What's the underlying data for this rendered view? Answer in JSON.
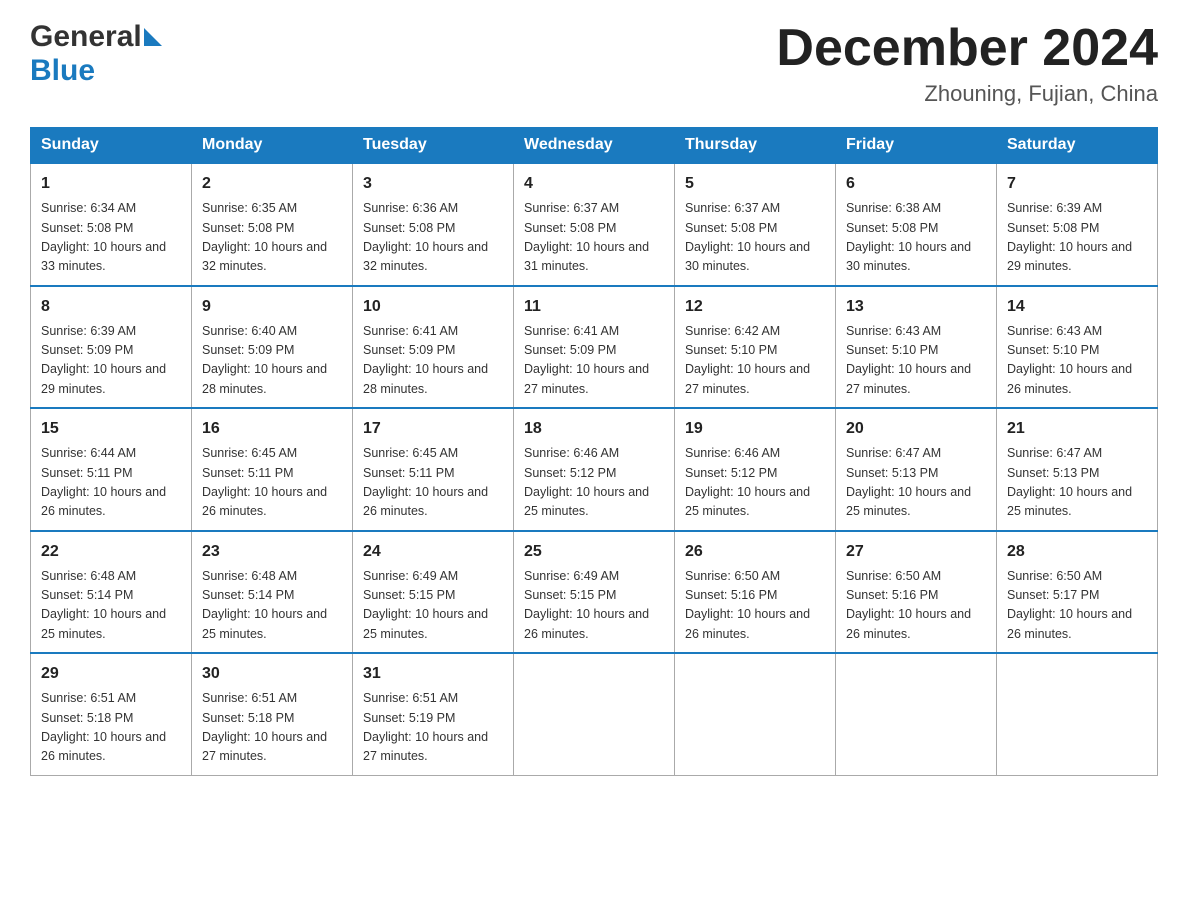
{
  "logo": {
    "general": "General",
    "blue": "Blue"
  },
  "title": {
    "month_year": "December 2024",
    "location": "Zhouning, Fujian, China"
  },
  "weekdays": [
    "Sunday",
    "Monday",
    "Tuesday",
    "Wednesday",
    "Thursday",
    "Friday",
    "Saturday"
  ],
  "weeks": [
    [
      {
        "day": "1",
        "sunrise": "6:34 AM",
        "sunset": "5:08 PM",
        "daylight": "10 hours and 33 minutes."
      },
      {
        "day": "2",
        "sunrise": "6:35 AM",
        "sunset": "5:08 PM",
        "daylight": "10 hours and 32 minutes."
      },
      {
        "day": "3",
        "sunrise": "6:36 AM",
        "sunset": "5:08 PM",
        "daylight": "10 hours and 32 minutes."
      },
      {
        "day": "4",
        "sunrise": "6:37 AM",
        "sunset": "5:08 PM",
        "daylight": "10 hours and 31 minutes."
      },
      {
        "day": "5",
        "sunrise": "6:37 AM",
        "sunset": "5:08 PM",
        "daylight": "10 hours and 30 minutes."
      },
      {
        "day": "6",
        "sunrise": "6:38 AM",
        "sunset": "5:08 PM",
        "daylight": "10 hours and 30 minutes."
      },
      {
        "day": "7",
        "sunrise": "6:39 AM",
        "sunset": "5:08 PM",
        "daylight": "10 hours and 29 minutes."
      }
    ],
    [
      {
        "day": "8",
        "sunrise": "6:39 AM",
        "sunset": "5:09 PM",
        "daylight": "10 hours and 29 minutes."
      },
      {
        "day": "9",
        "sunrise": "6:40 AM",
        "sunset": "5:09 PM",
        "daylight": "10 hours and 28 minutes."
      },
      {
        "day": "10",
        "sunrise": "6:41 AM",
        "sunset": "5:09 PM",
        "daylight": "10 hours and 28 minutes."
      },
      {
        "day": "11",
        "sunrise": "6:41 AM",
        "sunset": "5:09 PM",
        "daylight": "10 hours and 27 minutes."
      },
      {
        "day": "12",
        "sunrise": "6:42 AM",
        "sunset": "5:10 PM",
        "daylight": "10 hours and 27 minutes."
      },
      {
        "day": "13",
        "sunrise": "6:43 AM",
        "sunset": "5:10 PM",
        "daylight": "10 hours and 27 minutes."
      },
      {
        "day": "14",
        "sunrise": "6:43 AM",
        "sunset": "5:10 PM",
        "daylight": "10 hours and 26 minutes."
      }
    ],
    [
      {
        "day": "15",
        "sunrise": "6:44 AM",
        "sunset": "5:11 PM",
        "daylight": "10 hours and 26 minutes."
      },
      {
        "day": "16",
        "sunrise": "6:45 AM",
        "sunset": "5:11 PM",
        "daylight": "10 hours and 26 minutes."
      },
      {
        "day": "17",
        "sunrise": "6:45 AM",
        "sunset": "5:11 PM",
        "daylight": "10 hours and 26 minutes."
      },
      {
        "day": "18",
        "sunrise": "6:46 AM",
        "sunset": "5:12 PM",
        "daylight": "10 hours and 25 minutes."
      },
      {
        "day": "19",
        "sunrise": "6:46 AM",
        "sunset": "5:12 PM",
        "daylight": "10 hours and 25 minutes."
      },
      {
        "day": "20",
        "sunrise": "6:47 AM",
        "sunset": "5:13 PM",
        "daylight": "10 hours and 25 minutes."
      },
      {
        "day": "21",
        "sunrise": "6:47 AM",
        "sunset": "5:13 PM",
        "daylight": "10 hours and 25 minutes."
      }
    ],
    [
      {
        "day": "22",
        "sunrise": "6:48 AM",
        "sunset": "5:14 PM",
        "daylight": "10 hours and 25 minutes."
      },
      {
        "day": "23",
        "sunrise": "6:48 AM",
        "sunset": "5:14 PM",
        "daylight": "10 hours and 25 minutes."
      },
      {
        "day": "24",
        "sunrise": "6:49 AM",
        "sunset": "5:15 PM",
        "daylight": "10 hours and 25 minutes."
      },
      {
        "day": "25",
        "sunrise": "6:49 AM",
        "sunset": "5:15 PM",
        "daylight": "10 hours and 26 minutes."
      },
      {
        "day": "26",
        "sunrise": "6:50 AM",
        "sunset": "5:16 PM",
        "daylight": "10 hours and 26 minutes."
      },
      {
        "day": "27",
        "sunrise": "6:50 AM",
        "sunset": "5:16 PM",
        "daylight": "10 hours and 26 minutes."
      },
      {
        "day": "28",
        "sunrise": "6:50 AM",
        "sunset": "5:17 PM",
        "daylight": "10 hours and 26 minutes."
      }
    ],
    [
      {
        "day": "29",
        "sunrise": "6:51 AM",
        "sunset": "5:18 PM",
        "daylight": "10 hours and 26 minutes."
      },
      {
        "day": "30",
        "sunrise": "6:51 AM",
        "sunset": "5:18 PM",
        "daylight": "10 hours and 27 minutes."
      },
      {
        "day": "31",
        "sunrise": "6:51 AM",
        "sunset": "5:19 PM",
        "daylight": "10 hours and 27 minutes."
      },
      null,
      null,
      null,
      null
    ]
  ],
  "labels": {
    "sunrise": "Sunrise: ",
    "sunset": "Sunset: ",
    "daylight": "Daylight: "
  }
}
